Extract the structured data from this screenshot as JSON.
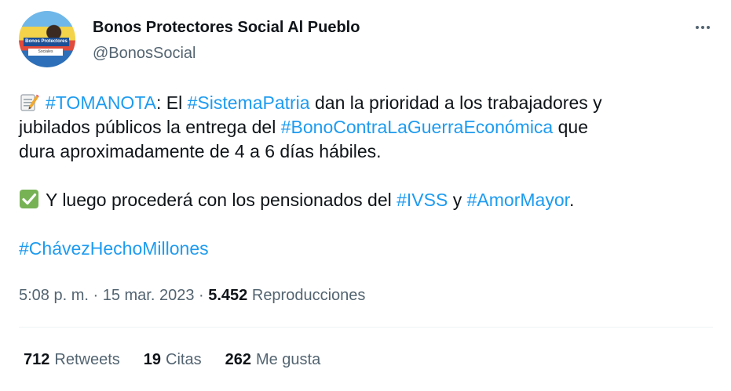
{
  "author": {
    "display_name": "Bonos Protectores Social Al Pueblo",
    "handle": "@BonosSocial",
    "avatar_text_1": "Bonos Protectores",
    "avatar_text_2": "Sociales"
  },
  "tweet": {
    "emoji1": "memo-icon",
    "p1_t1": "#TOMANOTA",
    "p1_t2": ": El ",
    "p1_t3": "#SistemaPatria",
    "p1_t4": " dan la prioridad a los trabajadores y",
    "p1_t5": "jubilados públicos la entrega del ",
    "p1_t6": "#BonoContraLaGuerraEconómica",
    "p1_t7": " que",
    "p1_t8": "dura aproximadamente de 4 a 6 días hábiles.",
    "emoji2": "check-mark-icon",
    "p2_t1": "Y luego procederá con los pensionados del ",
    "p2_t2": "#IVSS",
    "p2_t3": " y ",
    "p2_t4": "#AmorMayor",
    "p2_t5": ".",
    "p3_t1": "#ChávezHechoMillones"
  },
  "meta": {
    "time": "5:08 p. m.",
    "sep1": " · ",
    "date": "15 mar. 2023",
    "sep2": " · ",
    "views_count": "5.452",
    "views_label": " Reproducciones"
  },
  "stats": [
    {
      "count": "712",
      "label": "Retweets"
    },
    {
      "count": "19",
      "label": "Citas"
    },
    {
      "count": "262",
      "label": "Me gusta"
    }
  ],
  "colors": {
    "link": "#1d9bf0",
    "secondary": "#536471",
    "text": "#0f1419",
    "divider": "#eff3f4"
  }
}
